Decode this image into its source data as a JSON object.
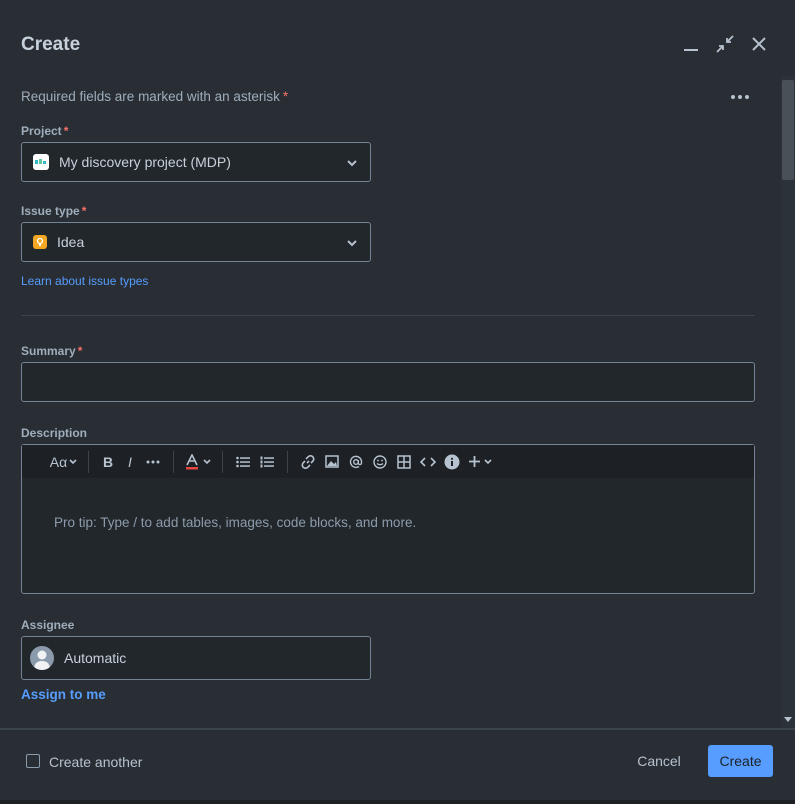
{
  "dialog": {
    "title": "Create"
  },
  "form": {
    "required_note": "Required fields are marked with an asterisk",
    "required_mark": "*",
    "project": {
      "label": "Project",
      "value": "My discovery project (MDP)",
      "icon": "project-avatar-icon",
      "icon_text": "MDP",
      "icon_color": "#ffffff"
    },
    "issue_type": {
      "label": "Issue type",
      "value": "Idea",
      "icon": "lightbulb-icon",
      "icon_color": "#f5a623"
    },
    "learn_link": "Learn about issue types",
    "summary": {
      "label": "Summary",
      "value": ""
    },
    "description": {
      "label": "Description",
      "placeholder": "Pro tip: Type / to add tables, images, code blocks, and more.",
      "toolbar": {
        "text_style": "Aα",
        "bold": "B",
        "italic": "I"
      }
    },
    "assignee": {
      "label": "Assignee",
      "value": "Automatic",
      "assign_me": "Assign to me"
    }
  },
  "footer": {
    "create_another": "Create another",
    "cancel": "Cancel",
    "create": "Create"
  },
  "colors": {
    "accent": "#579dff",
    "required": "#f87168",
    "background": "#282e33"
  }
}
